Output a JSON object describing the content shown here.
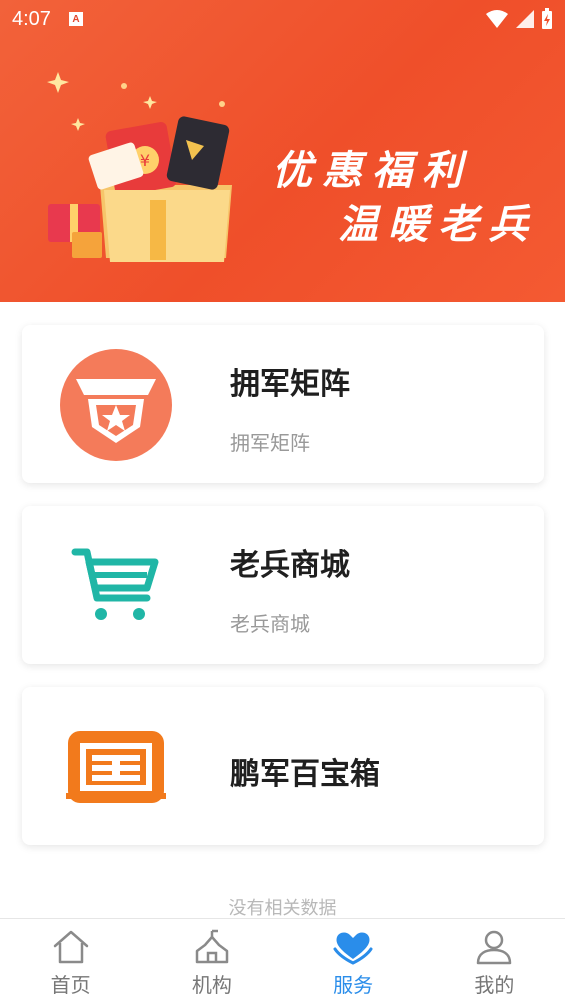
{
  "status_bar": {
    "time": "4:07",
    "notification_badge": "A"
  },
  "banner": {
    "line1": "优惠福利",
    "line2": "温暖老兵"
  },
  "services": [
    {
      "title": "拥军矩阵",
      "subtitle": "拥军矩阵",
      "icon": "shield-star-icon",
      "color": "#f47b5a"
    },
    {
      "title": "老兵商城",
      "subtitle": "老兵商城",
      "icon": "shopping-cart-icon",
      "color": "#20b6a6"
    },
    {
      "title": "鹏军百宝箱",
      "subtitle": "",
      "icon": "treasure-box-icon",
      "color": "#f27a1c"
    }
  ],
  "empty_message": "没有相关数据",
  "tabbar": {
    "items": [
      {
        "label": "首页",
        "icon": "home-icon"
      },
      {
        "label": "机构",
        "icon": "building-icon"
      },
      {
        "label": "服务",
        "icon": "heart-hands-icon"
      },
      {
        "label": "我的",
        "icon": "user-icon"
      }
    ],
    "active_index": 2,
    "active_color": "#2a8dea"
  }
}
